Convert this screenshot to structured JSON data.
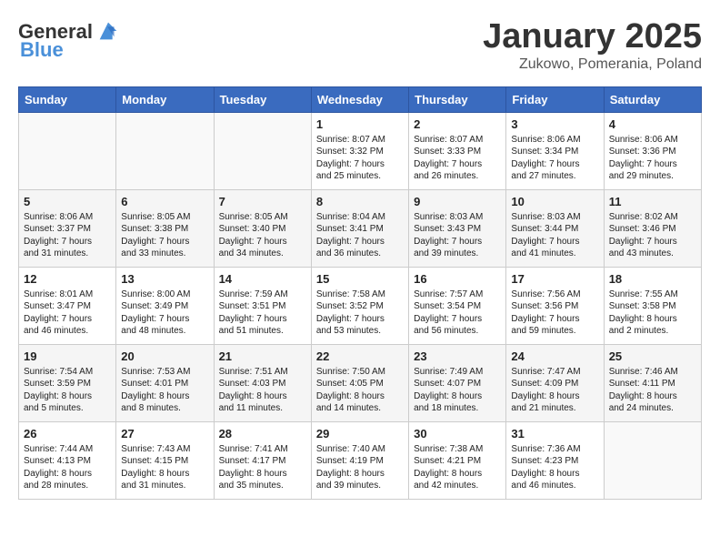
{
  "header": {
    "logo_general": "General",
    "logo_blue": "Blue",
    "title": "January 2025",
    "subtitle": "Zukowo, Pomerania, Poland"
  },
  "weekdays": [
    "Sunday",
    "Monday",
    "Tuesday",
    "Wednesday",
    "Thursday",
    "Friday",
    "Saturday"
  ],
  "weeks": [
    [
      {
        "day": "",
        "content": ""
      },
      {
        "day": "",
        "content": ""
      },
      {
        "day": "",
        "content": ""
      },
      {
        "day": "1",
        "content": "Sunrise: 8:07 AM\nSunset: 3:32 PM\nDaylight: 7 hours\nand 25 minutes."
      },
      {
        "day": "2",
        "content": "Sunrise: 8:07 AM\nSunset: 3:33 PM\nDaylight: 7 hours\nand 26 minutes."
      },
      {
        "day": "3",
        "content": "Sunrise: 8:06 AM\nSunset: 3:34 PM\nDaylight: 7 hours\nand 27 minutes."
      },
      {
        "day": "4",
        "content": "Sunrise: 8:06 AM\nSunset: 3:36 PM\nDaylight: 7 hours\nand 29 minutes."
      }
    ],
    [
      {
        "day": "5",
        "content": "Sunrise: 8:06 AM\nSunset: 3:37 PM\nDaylight: 7 hours\nand 31 minutes."
      },
      {
        "day": "6",
        "content": "Sunrise: 8:05 AM\nSunset: 3:38 PM\nDaylight: 7 hours\nand 33 minutes."
      },
      {
        "day": "7",
        "content": "Sunrise: 8:05 AM\nSunset: 3:40 PM\nDaylight: 7 hours\nand 34 minutes."
      },
      {
        "day": "8",
        "content": "Sunrise: 8:04 AM\nSunset: 3:41 PM\nDaylight: 7 hours\nand 36 minutes."
      },
      {
        "day": "9",
        "content": "Sunrise: 8:03 AM\nSunset: 3:43 PM\nDaylight: 7 hours\nand 39 minutes."
      },
      {
        "day": "10",
        "content": "Sunrise: 8:03 AM\nSunset: 3:44 PM\nDaylight: 7 hours\nand 41 minutes."
      },
      {
        "day": "11",
        "content": "Sunrise: 8:02 AM\nSunset: 3:46 PM\nDaylight: 7 hours\nand 43 minutes."
      }
    ],
    [
      {
        "day": "12",
        "content": "Sunrise: 8:01 AM\nSunset: 3:47 PM\nDaylight: 7 hours\nand 46 minutes."
      },
      {
        "day": "13",
        "content": "Sunrise: 8:00 AM\nSunset: 3:49 PM\nDaylight: 7 hours\nand 48 minutes."
      },
      {
        "day": "14",
        "content": "Sunrise: 7:59 AM\nSunset: 3:51 PM\nDaylight: 7 hours\nand 51 minutes."
      },
      {
        "day": "15",
        "content": "Sunrise: 7:58 AM\nSunset: 3:52 PM\nDaylight: 7 hours\nand 53 minutes."
      },
      {
        "day": "16",
        "content": "Sunrise: 7:57 AM\nSunset: 3:54 PM\nDaylight: 7 hours\nand 56 minutes."
      },
      {
        "day": "17",
        "content": "Sunrise: 7:56 AM\nSunset: 3:56 PM\nDaylight: 7 hours\nand 59 minutes."
      },
      {
        "day": "18",
        "content": "Sunrise: 7:55 AM\nSunset: 3:58 PM\nDaylight: 8 hours\nand 2 minutes."
      }
    ],
    [
      {
        "day": "19",
        "content": "Sunrise: 7:54 AM\nSunset: 3:59 PM\nDaylight: 8 hours\nand 5 minutes."
      },
      {
        "day": "20",
        "content": "Sunrise: 7:53 AM\nSunset: 4:01 PM\nDaylight: 8 hours\nand 8 minutes."
      },
      {
        "day": "21",
        "content": "Sunrise: 7:51 AM\nSunset: 4:03 PM\nDaylight: 8 hours\nand 11 minutes."
      },
      {
        "day": "22",
        "content": "Sunrise: 7:50 AM\nSunset: 4:05 PM\nDaylight: 8 hours\nand 14 minutes."
      },
      {
        "day": "23",
        "content": "Sunrise: 7:49 AM\nSunset: 4:07 PM\nDaylight: 8 hours\nand 18 minutes."
      },
      {
        "day": "24",
        "content": "Sunrise: 7:47 AM\nSunset: 4:09 PM\nDaylight: 8 hours\nand 21 minutes."
      },
      {
        "day": "25",
        "content": "Sunrise: 7:46 AM\nSunset: 4:11 PM\nDaylight: 8 hours\nand 24 minutes."
      }
    ],
    [
      {
        "day": "26",
        "content": "Sunrise: 7:44 AM\nSunset: 4:13 PM\nDaylight: 8 hours\nand 28 minutes."
      },
      {
        "day": "27",
        "content": "Sunrise: 7:43 AM\nSunset: 4:15 PM\nDaylight: 8 hours\nand 31 minutes."
      },
      {
        "day": "28",
        "content": "Sunrise: 7:41 AM\nSunset: 4:17 PM\nDaylight: 8 hours\nand 35 minutes."
      },
      {
        "day": "29",
        "content": "Sunrise: 7:40 AM\nSunset: 4:19 PM\nDaylight: 8 hours\nand 39 minutes."
      },
      {
        "day": "30",
        "content": "Sunrise: 7:38 AM\nSunset: 4:21 PM\nDaylight: 8 hours\nand 42 minutes."
      },
      {
        "day": "31",
        "content": "Sunrise: 7:36 AM\nSunset: 4:23 PM\nDaylight: 8 hours\nand 46 minutes."
      },
      {
        "day": "",
        "content": ""
      }
    ]
  ]
}
